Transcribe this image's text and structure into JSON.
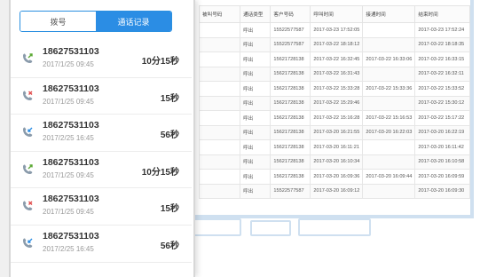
{
  "tabs": {
    "dial": "拨号",
    "log": "通话记录"
  },
  "calls": [
    {
      "number": "18627531103",
      "date": "2017/1/25 09:45",
      "duration": "10分15秒",
      "type": "outgoing"
    },
    {
      "number": "18627531103",
      "date": "2017/1/25 09:45",
      "duration": "15秒",
      "type": "missed"
    },
    {
      "number": "18627531103",
      "date": "2017/2/25 16:45",
      "duration": "56秒",
      "type": "incoming"
    },
    {
      "number": "18627531103",
      "date": "2017/1/25 09:45",
      "duration": "10分15秒",
      "type": "outgoing"
    },
    {
      "number": "18627531103",
      "date": "2017/1/25 09:45",
      "duration": "15秒",
      "type": "missed"
    },
    {
      "number": "18627531103",
      "date": "2017/2/25 16:45",
      "duration": "56秒",
      "type": "incoming"
    }
  ],
  "table": {
    "headers": [
      "被叫号码",
      "通话类型",
      "客户号码",
      "呼叫时间",
      "接通时间",
      "结束时间"
    ],
    "rows": [
      [
        "",
        "呼出",
        "15522577587",
        "2017-03-23 17:52:05",
        "",
        "2017-03-23 17:52:24"
      ],
      [
        "",
        "呼出",
        "15522577587",
        "2017-03-22 18:18:12",
        "",
        "2017-03-22 18:18:35"
      ],
      [
        "",
        "呼出",
        "15621728138",
        "2017-03-22 16:32:45",
        "2017-03-22 16:33:06",
        "2017-03-22 16:33:15"
      ],
      [
        "",
        "呼出",
        "15621728138",
        "2017-03-22 16:31:43",
        "",
        "2017-03-22 16:32:11"
      ],
      [
        "",
        "呼出",
        "15621728138",
        "2017-03-22 15:33:28",
        "2017-03-22 15:33:36",
        "2017-03-22 15:33:52"
      ],
      [
        "",
        "呼出",
        "15621728138",
        "2017-03-22 15:29:46",
        "",
        "2017-03-22 15:30:12"
      ],
      [
        "",
        "呼出",
        "15621728138",
        "2017-03-22 15:16:28",
        "2017-03-22 15:16:53",
        "2017-03-22 15:17:22"
      ],
      [
        "",
        "呼出",
        "15621728138",
        "2017-03-20 16:21:55",
        "2017-03-20 16:22:03",
        "2017-03-20 16:22:19"
      ],
      [
        "",
        "呼出",
        "15621728138",
        "2017-03-20 16:11:21",
        "",
        "2017-03-20 16:11:42"
      ],
      [
        "",
        "呼出",
        "15621728138",
        "2017-03-20 16:10:34",
        "",
        "2017-03-20 16:10:58"
      ],
      [
        "",
        "呼出",
        "15621728138",
        "2017-03-20 16:09:36",
        "2017-03-20 16:09:44",
        "2017-03-20 16:09:59"
      ],
      [
        "",
        "呼出",
        "15522577587",
        "2017-03-20 16:09:12",
        "",
        "2017-03-20 16:09:30"
      ]
    ]
  },
  "colors": {
    "accent": "#2b8de4",
    "outgoing_icon": "#5aa832",
    "missed_icon": "#e04a4a",
    "incoming_icon": "#2b8de4"
  }
}
